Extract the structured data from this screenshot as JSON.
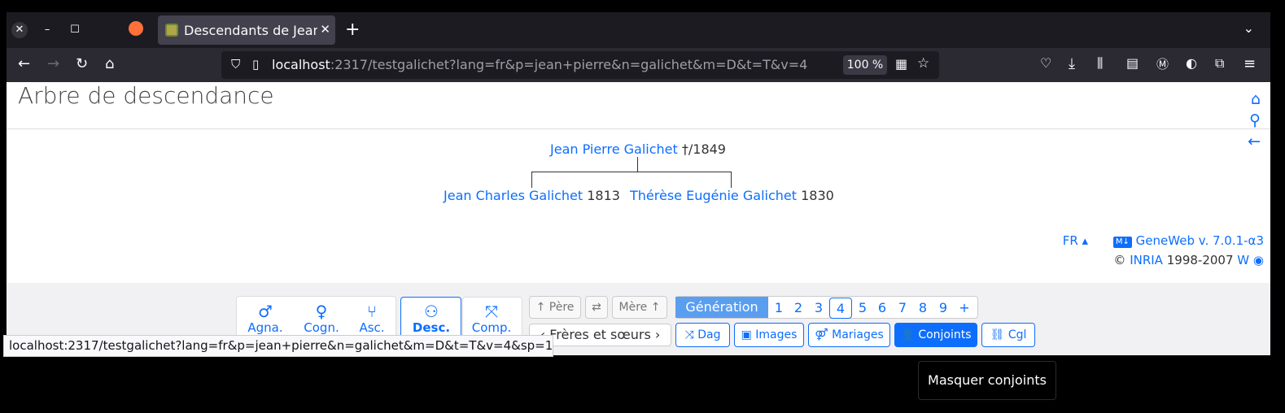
{
  "browser": {
    "tab_title": "Descendants de Jean",
    "url_host": "localhost",
    "url_rest": ":2317/testgalichet?lang=fr&p=jean+pierre&n=galichet&m=D&t=T&v=4",
    "zoom": "100 %",
    "status_url": "localhost:2317/testgalichet?lang=fr&p=jean+pierre&n=galichet&m=D&t=T&v=4&sp=1"
  },
  "page": {
    "heading": "Arbre de descendance",
    "root": {
      "name": "Jean Pierre Galichet",
      "dates": "†/1849"
    },
    "children": [
      {
        "name": "Jean Charles Galichet",
        "dates": "1813"
      },
      {
        "name": "Thérèse Eugénie Galichet",
        "dates": "1830"
      }
    ]
  },
  "footer": {
    "lang": "FR",
    "version": "GeneWeb v. 7.0.1-α3",
    "copyright_prefix": "©",
    "inria": "INRIA",
    "years": "1998-2007"
  },
  "toolbar": {
    "nav": [
      {
        "label": "Agna.",
        "icon": "male-icon"
      },
      {
        "label": "Cogn.",
        "icon": "female-icon"
      },
      {
        "label": "Asc.",
        "icon": "ascendants-icon"
      },
      {
        "label": "Desc.",
        "icon": "descendants-icon"
      },
      {
        "label": "Comp.",
        "icon": "compress-icon"
      }
    ],
    "pere": "Père",
    "mere": "Mère",
    "freres": "Frères et sœurs",
    "generation_label": "Génération",
    "generations": [
      "1",
      "2",
      "3",
      "4",
      "5",
      "6",
      "7",
      "8",
      "9",
      "+"
    ],
    "selected_generation": "4",
    "buttons": {
      "dag": "Dag",
      "images": "Images",
      "mariages": "Mariages",
      "conjoints": "Conjoints",
      "cgl": "Cgl"
    }
  },
  "tooltip": "Masquer conjoints"
}
